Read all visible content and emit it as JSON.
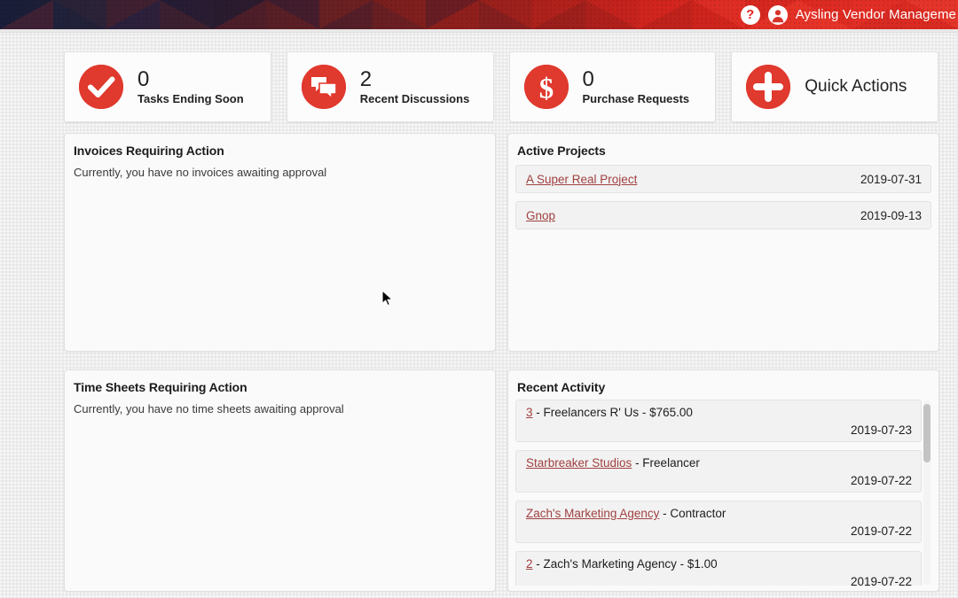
{
  "header": {
    "title": "Aysling Vendor Manageme",
    "help_icon": "question-mark-icon",
    "avatar_icon": "user-avatar-icon",
    "gradient_left": "#23243f",
    "gradient_right": "#e03228"
  },
  "theme": {
    "accent_red": "#e0392d",
    "link_red": "#a04040",
    "page_background": "#ececec",
    "panel_background": "#fafafa"
  },
  "stats": [
    {
      "value": "0",
      "label": "Tasks Ending Soon",
      "icon": "check-circle-icon"
    },
    {
      "value": "2",
      "label": "Recent Discussions",
      "icon": "chat-bubbles-icon"
    },
    {
      "value": "0",
      "label": "Purchase Requests",
      "icon": "dollar-sign-icon"
    },
    {
      "value": "",
      "label": "Quick Actions",
      "icon": "plus-circle-icon"
    }
  ],
  "panels": {
    "invoices": {
      "title": "Invoices Requiring Action",
      "empty_text": "Currently, you have no invoices awaiting approval"
    },
    "timesheets": {
      "title": "Time Sheets Requiring Action",
      "empty_text": "Currently, you have no time sheets awaiting approval"
    },
    "projects": {
      "title": "Active Projects",
      "rows": [
        {
          "name": "A Super Real Project",
          "date": "2019-07-31"
        },
        {
          "name": "Gnop",
          "date": "2019-09-13"
        }
      ]
    },
    "activity": {
      "title": "Recent Activity",
      "rows": [
        {
          "link": "3",
          "rest": " - Freelancers R' Us - $765.00",
          "date": "2019-07-23"
        },
        {
          "link": "Starbreaker Studios",
          "rest": " - Freelancer",
          "date": "2019-07-22"
        },
        {
          "link": "Zach's Marketing Agency",
          "rest": " - Contractor",
          "date": "2019-07-22"
        },
        {
          "link": "2",
          "rest": " - Zach's Marketing Agency - $1.00",
          "date": "2019-07-22"
        }
      ]
    }
  }
}
